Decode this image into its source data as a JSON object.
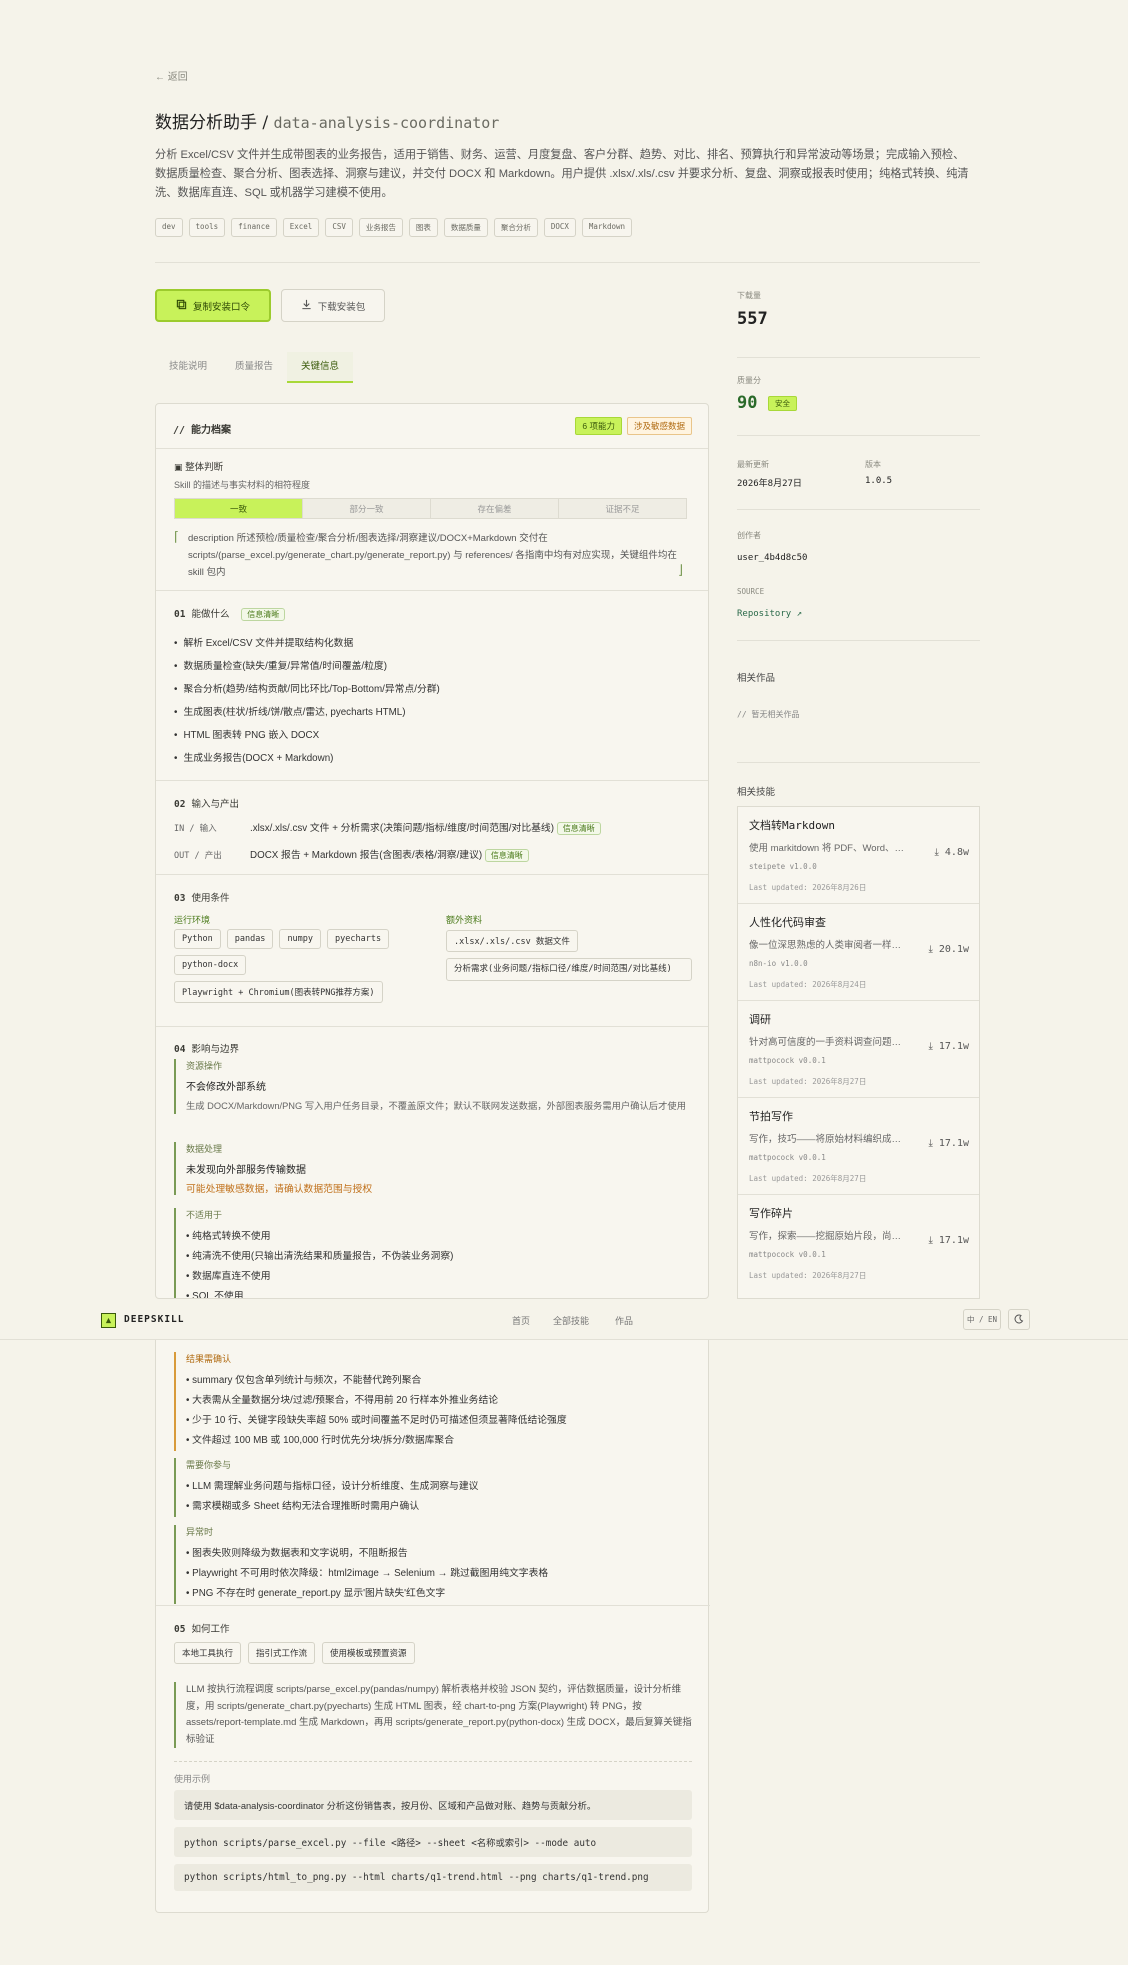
{
  "header": {
    "back": "← 返回",
    "title": "数据分析助手",
    "slug": "data-analysis-coordinator",
    "description": "分析 Excel/CSV 文件并生成带图表的业务报告，适用于销售、财务、运营、月度复盘、客户分群、趋势、对比、排名、预算执行和异常波动等场景；完成输入预检、数据质量检查、聚合分析、图表选择、洞察与建议，并交付 DOCX 和 Markdown。用户提供 .xlsx/.xls/.csv 并要求分析、复盘、洞察或报表时使用；纯格式转换、纯清洗、数据库直连、SQL 或机器学习建模不使用。",
    "tags": [
      "dev",
      "tools",
      "finance",
      "Excel",
      "CSV",
      "业务报告",
      "图表",
      "数据质量",
      "聚合分析",
      "DOCX",
      "Markdown"
    ]
  },
  "actions": {
    "copy": "复制安装口令",
    "download": "下载安装包"
  },
  "tabs": [
    "技能说明",
    "质量报告",
    "关键信息"
  ],
  "profile": {
    "title": "// 能力档案",
    "badge_count": "6 项能力",
    "badge_sensitive": "涉及敏感数据",
    "judge_title": "整体判断",
    "judge_sub": "Skill 的描述与事实材料的相符程度",
    "segments": [
      "一致",
      "部分一致",
      "存在偏差",
      "证据不足"
    ],
    "quote": "description 所述预检/质量检查/聚合分析/图表选择/洞察建议/DOCX+Markdown 交付在 scripts/(parse_excel.py/generate_chart.py/generate_report.py) 与 references/ 各指南中均有对应实现，关键组件均在 skill 包内"
  },
  "s01": {
    "num": "01",
    "title": "能做什么",
    "pill": "信息清晰",
    "items": [
      "解析 Excel/CSV 文件并提取结构化数据",
      "数据质量检查(缺失/重复/异常值/时间覆盖/粒度)",
      "聚合分析(趋势/结构贡献/同比环比/Top-Bottom/异常点/分群)",
      "生成图表(柱状/折线/饼/散点/雷达, pyecharts HTML)",
      "HTML 图表转 PNG 嵌入 DOCX",
      "生成业务报告(DOCX + Markdown)"
    ]
  },
  "s02": {
    "num": "02",
    "title": "输入与产出",
    "in_label": "IN / 输入",
    "in_text": ".xlsx/.xls/.csv 文件 + 分析需求(决策问题/指标/维度/时间范围/对比基线)",
    "in_pill": "信息清晰",
    "out_label": "OUT / 产出",
    "out_text": "DOCX 报告 + Markdown 报告(含图表/表格/洞察/建议)",
    "out_pill": "信息清晰"
  },
  "s03": {
    "num": "03",
    "title": "使用条件",
    "env_label": "运行环境",
    "env": [
      "Python",
      "pandas",
      "numpy",
      "pyecharts",
      "python-docx",
      "Playwright + Chromium(图表转PNG推荐方案)"
    ],
    "extra_label": "额外资料",
    "extra": [
      ".xlsx/.xls/.csv 数据文件",
      "分析需求(业务问题/指标口径/维度/时间范围/对比基线)"
    ]
  },
  "s04": {
    "num": "04",
    "title": "影响与边界",
    "res_h": "资源操作",
    "res_t": "不会修改外部系统",
    "res_s": "生成 DOCX/Markdown/PNG 写入用户任务目录，不覆盖原文件；默认不联网发送数据，外部图表服务需用户确认后才使用",
    "data_h": "数据处理",
    "data_t": "未发现向外部服务传输数据",
    "data_w": "可能处理敏感数据，请确认数据范围与授权",
    "na_h": "不适用于",
    "na": [
      "纯格式转换不使用",
      "纯清洗不使用(只输出清洗结果和质量报告，不伪装业务洞察)",
      "数据库直连不使用",
      "SQL 不使用"
    ],
    "confirm_h": "结果需确认",
    "confirm": [
      "summary 仅包含单列统计与频次，不能替代跨列聚合",
      "大表需从全量数据分块/过滤/预聚合，不得用前 20 行样本外推业务结论",
      "少于 10 行、关键字段缺失率超 50% 或时间覆盖不足时仍可描述但须显著降低结论强度",
      "文件超过 100 MB 或 100,000 行时优先分块/拆分/数据库聚合"
    ],
    "you_h": "需要你参与",
    "you": [
      "LLM 需理解业务问题与指标口径，设计分析维度、生成洞察与建议",
      "需求模糊或多 Sheet 结构无法合理推断时需用户确认"
    ],
    "err_h": "异常时",
    "err": [
      "图表失败则降级为数据表和文字说明，不阻断报告",
      "Playwright 不可用时依次降级：html2image → Selenium → 跳过截图用纯文字表格",
      "PNG 不存在时 generate_report.py 显示'图片缺失'红色文字"
    ]
  },
  "s05": {
    "num": "05",
    "title": "如何工作",
    "chips": [
      "本地工具执行",
      "指引式工作流",
      "使用模板或预置资源"
    ],
    "note": "LLM 按执行流程调度 scripts/parse_excel.py(pandas/numpy) 解析表格并校验 JSON 契约，评估数据质量，设计分析维度，用 scripts/generate_chart.py(pyecharts) 生成 HTML 图表，经 chart-to-png 方案(Playwright) 转 PNG，按 assets/report-template.md 生成 Markdown，再用 scripts/generate_report.py(python-docx) 生成 DOCX，最后复算关键指标验证",
    "example_label": "使用示例",
    "prompt": "请使用 $data-analysis-coordinator 分析这份销售表，按月份、区域和产品做对账、趋势与贡献分析。",
    "cmd1": "python scripts/parse_excel.py --file <路径> --sheet <名称或索引> --mode auto",
    "cmd2": "python scripts/html_to_png.py --html charts/q1-trend.html --png charts/q1-trend.png"
  },
  "side": {
    "downloads_label": "下载量",
    "downloads": "557",
    "quality_label": "质量分",
    "quality": "90",
    "quality_badge": "安全",
    "updated_label": "最新更新",
    "updated": "2026年8月27日",
    "version_label": "版本",
    "version": "1.0.5",
    "author_label": "创作者",
    "author": "user_4b4d8c50",
    "source_label": "SOURCE",
    "source": "Repository ↗",
    "related_works_label": "相关作品",
    "related_works_empty": "// 暂无相关作品",
    "related_skills_label": "相关技能",
    "related": [
      {
        "title": "文档转Markdown",
        "desc": "使用 markitdown 将 PDF、Word、…",
        "meta": "steipete  v1.0.0",
        "updated": "Last updated: 2026年8月26日",
        "dl": "4.8w"
      },
      {
        "title": "人性化代码审查",
        "desc": "像一位深思熟虑的人类审阅者一样…",
        "meta": "n8n-io  v1.0.0",
        "updated": "Last updated: 2026年8月24日",
        "dl": "20.1w"
      },
      {
        "title": "调研",
        "desc": "针对高可信度的一手资料调查问题…",
        "meta": "mattpocock  v0.0.1",
        "updated": "Last updated: 2026年8月27日",
        "dl": "17.1w"
      },
      {
        "title": "节拍写作",
        "desc": "写作，技巧——将原始材料编织成…",
        "meta": "mattpocock  v0.0.1",
        "updated": "Last updated: 2026年8月27日",
        "dl": "17.1w"
      },
      {
        "title": "写作碎片",
        "desc": "写作，探索——挖掘原始片段，尚…",
        "meta": "mattpocock  v0.0.1",
        "updated": "Last updated: 2026年8月27日",
        "dl": "17.1w"
      }
    ]
  },
  "nav": {
    "brand": "DEEPSKILL",
    "links": [
      "首页",
      "全部技能",
      "作品"
    ],
    "lang": "中 / EN"
  }
}
